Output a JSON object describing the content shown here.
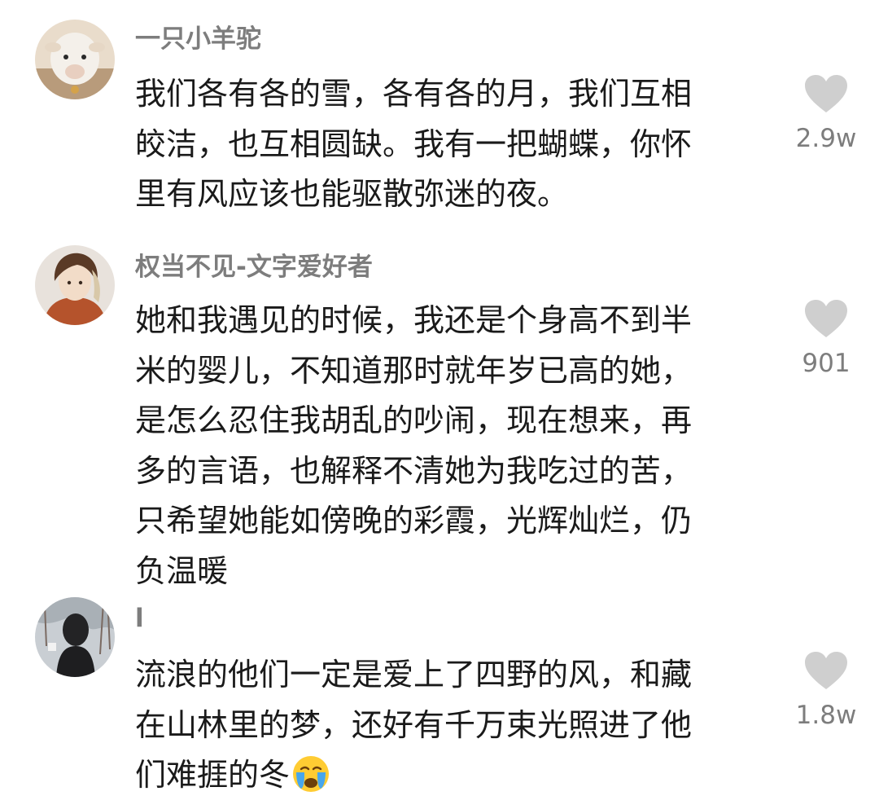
{
  "comments": [
    {
      "username": "一只小羊驼",
      "text": "我们各有各的雪，各有各的月，我们互相\n皎洁，也互相圆缺。我有一把蝴蝶，你怀\n里有风应该也能驱散弥迷的夜。",
      "likes": "2.9w",
      "avatar_icon": "alpaca-avatar"
    },
    {
      "username": "权当不见-文字爱好者",
      "text": "她和我遇见的时候，我还是个身高不到半\n米的婴儿，不知道那时就年岁已高的她，\n是怎么忍住我胡乱的吵闹，现在想来，再\n多的言语，也解释不清她为我吃过的苦，\n只希望她能如傍晚的彩霞，光辉灿烂，仍\n负温暖",
      "likes": "901",
      "avatar_icon": "anime-character-avatar"
    },
    {
      "username": "l",
      "text": "流浪的他们一定是爱上了四野的风，和藏\n在山林里的梦，还好有千万束光照进了他\n们难捱的冬",
      "likes": "1.8w",
      "avatar_icon": "hooded-person-avatar",
      "trailing_emoji": "crying-face-emoji"
    }
  ],
  "colors": {
    "username": "#7d7d7d",
    "text": "#1a1a1a",
    "heart": "#cfcfcf",
    "background": "#ffffff"
  }
}
